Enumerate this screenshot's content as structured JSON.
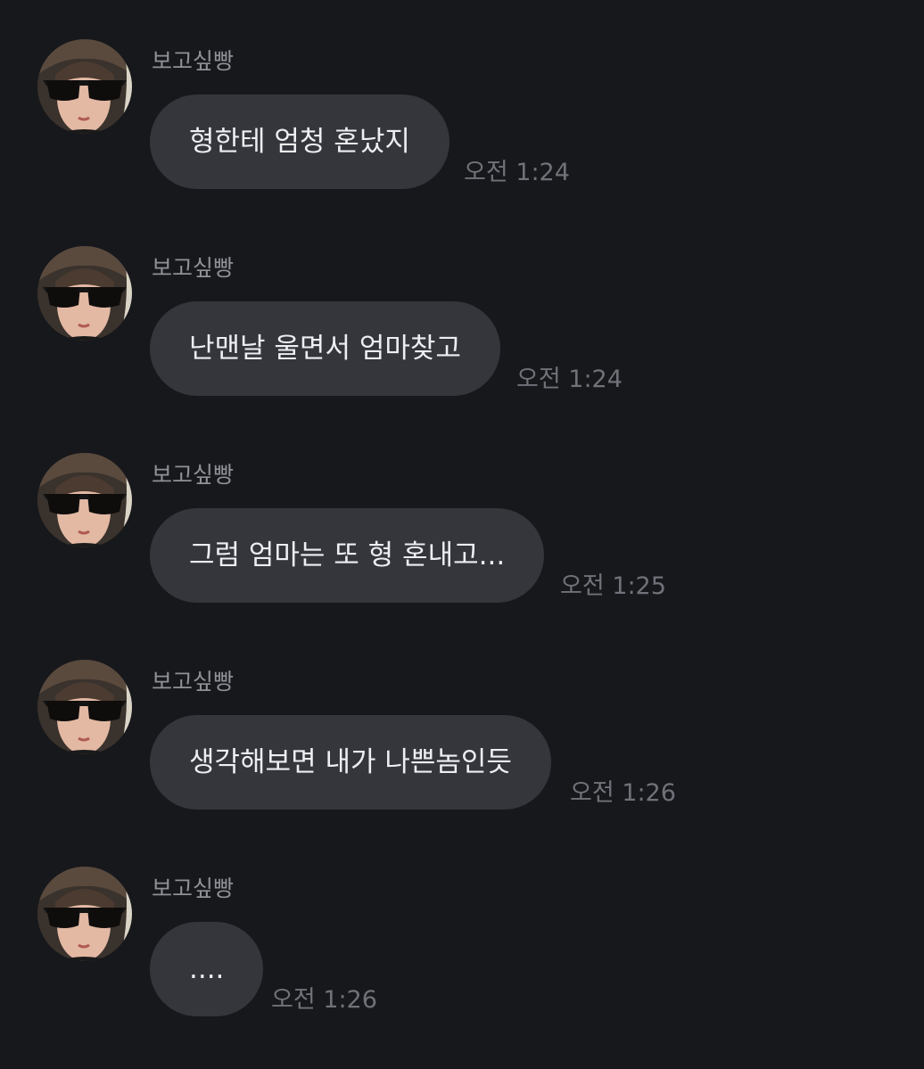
{
  "messages": [
    {
      "sender": "보고싶빵",
      "text": "형한테 엄청 혼났지",
      "time": "오전 1:24"
    },
    {
      "sender": "보고싶빵",
      "text": "난맨날 울면서 엄마찾고",
      "time": "오전 1:24"
    },
    {
      "sender": "보고싶빵",
      "text": "그럼 엄마는 또 형 혼내고...",
      "time": "오전 1:25"
    },
    {
      "sender": "보고싶빵",
      "text": "생각해보면 내가 나쁜놈인듯",
      "time": "오전 1:26"
    },
    {
      "sender": "보고싶빵",
      "text": "....",
      "time": "오전 1:26"
    }
  ],
  "colors": {
    "background": "#17181c",
    "bubble": "#34363c",
    "message_text": "#eceef2",
    "sender_text": "#8f9197",
    "time_text": "#6f7278"
  }
}
